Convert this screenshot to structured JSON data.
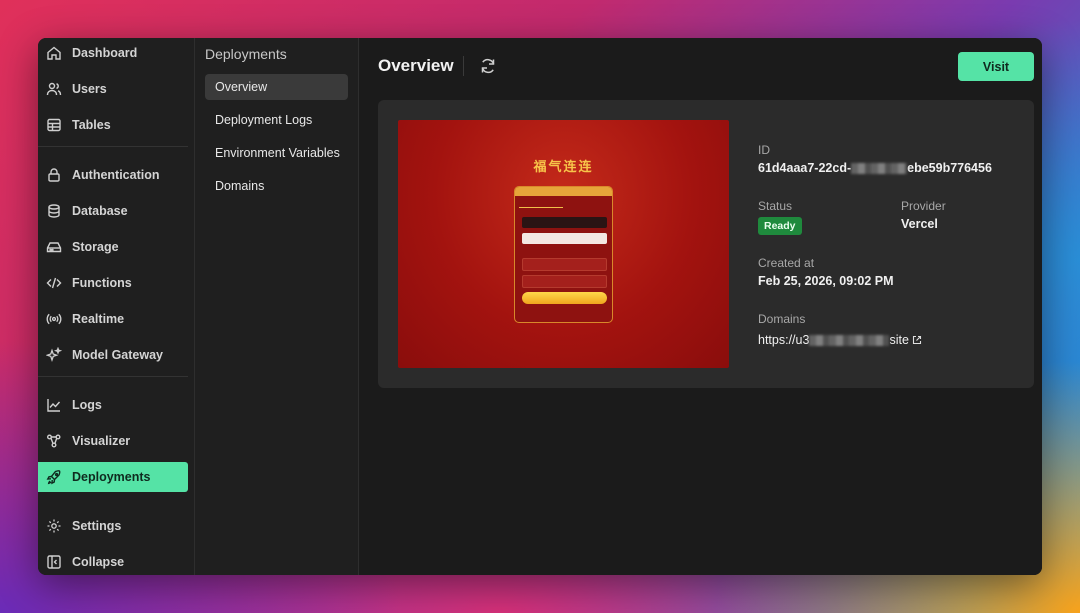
{
  "nav": {
    "items": [
      {
        "label": "Dashboard",
        "icon": "home-icon"
      },
      {
        "label": "Users",
        "icon": "users-icon"
      },
      {
        "label": "Tables",
        "icon": "table-icon"
      },
      {
        "label": "Authentication",
        "icon": "lock-icon"
      },
      {
        "label": "Database",
        "icon": "database-icon"
      },
      {
        "label": "Storage",
        "icon": "storage-icon"
      },
      {
        "label": "Functions",
        "icon": "code-icon"
      },
      {
        "label": "Realtime",
        "icon": "broadcast-icon"
      },
      {
        "label": "Model Gateway",
        "icon": "sparkles-icon"
      },
      {
        "label": "Logs",
        "icon": "chart-line-icon"
      },
      {
        "label": "Visualizer",
        "icon": "graph-icon"
      },
      {
        "label": "Deployments",
        "icon": "rocket-icon",
        "active": true
      },
      {
        "label": "Settings",
        "icon": "gear-icon"
      },
      {
        "label": "Collapse",
        "icon": "collapse-icon"
      }
    ]
  },
  "subnav": {
    "title": "Deployments",
    "items": [
      {
        "label": "Overview",
        "active": true
      },
      {
        "label": "Deployment Logs"
      },
      {
        "label": "Environment Variables"
      },
      {
        "label": "Domains"
      }
    ]
  },
  "main": {
    "title": "Overview",
    "visit_label": "Visit",
    "preview": {
      "title": "福气连连"
    },
    "details": {
      "id_label": "ID",
      "id_value_start": "61d4aaa7-22cd-",
      "id_value_end": "ebe59b776456",
      "status_label": "Status",
      "status_value": "Ready",
      "provider_label": "Provider",
      "provider_value": "Vercel",
      "created_label": "Created at",
      "created_value": "Feb 25, 2026, 09:02 PM",
      "domains_label": "Domains",
      "domain_start": "https://u3",
      "domain_end": "site"
    }
  },
  "colors": {
    "accent": "#55e3a6",
    "status_ready": "#1f8a3d"
  }
}
